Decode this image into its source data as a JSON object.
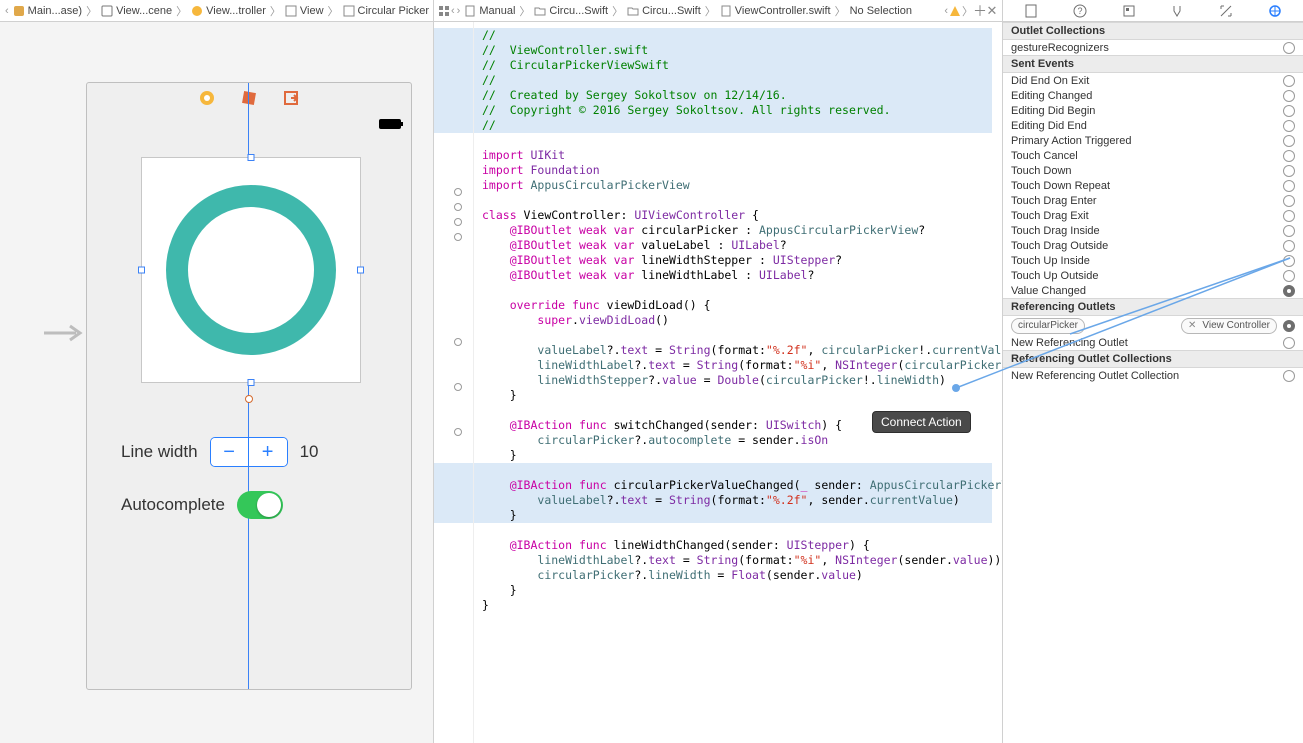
{
  "left": {
    "breadcrumb": [
      "Main...ase)",
      "View...cene",
      "View...troller",
      "View",
      "Circular Picker"
    ],
    "device": {
      "line_width_label": "Line width",
      "line_width_value": "10",
      "autocomplete_label": "Autocomplete"
    }
  },
  "mid": {
    "toolbar": {
      "manual": "Manual",
      "tabs": [
        "Circu...Swift",
        "Circu...Swift",
        "ViewController.swift"
      ],
      "selection": "No Selection"
    },
    "code_comment_lines": [
      "//",
      "//  ViewController.swift",
      "//  CircularPickerViewSwift",
      "//",
      "//  Created by Sergey Sokoltsov on 12/14/16.",
      "//  Copyright © 2016 Sergey Sokoltsov. All rights reserved.",
      "//"
    ],
    "tooltip": "Connect Action"
  },
  "right": {
    "sections": {
      "outlet_collections": "Outlet Collections",
      "sent_events": "Sent Events",
      "referencing_outlets": "Referencing Outlets",
      "referencing_outlet_collections": "Referencing Outlet Collections"
    },
    "outlet_collections": [
      "gestureRecognizers"
    ],
    "sent_events": [
      "Did End On Exit",
      "Editing Changed",
      "Editing Did Begin",
      "Editing Did End",
      "Primary Action Triggered",
      "Touch Cancel",
      "Touch Down",
      "Touch Down Repeat",
      "Touch Drag Enter",
      "Touch Drag Exit",
      "Touch Drag Inside",
      "Touch Drag Outside",
      "Touch Up Inside",
      "Touch Up Outside",
      "Value Changed"
    ],
    "referencing_outlets": {
      "connected_name": "circularPicker",
      "connected_to": "View Controller",
      "new": "New Referencing Outlet"
    },
    "referencing_outlet_collections": {
      "new": "New Referencing Outlet Collection"
    }
  }
}
